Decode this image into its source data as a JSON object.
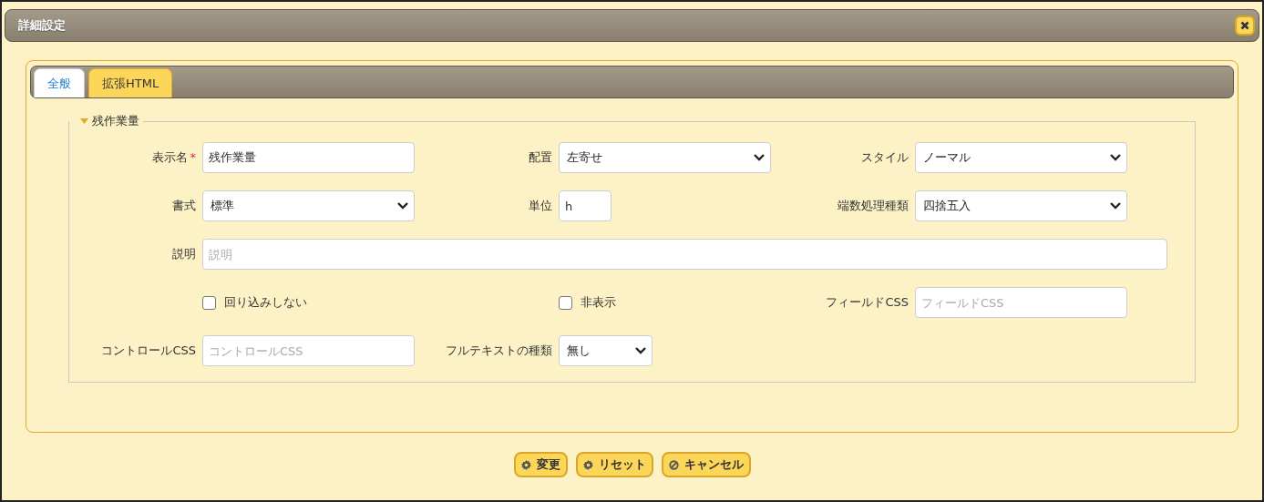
{
  "window": {
    "title": "詳細設定"
  },
  "tabs": [
    {
      "label": "全般",
      "selected": true
    },
    {
      "label": "拡張HTML",
      "selected": false
    }
  ],
  "section": {
    "title": "残作業量",
    "expanded": true
  },
  "rows": [
    [
      {
        "kind": "text",
        "label": "表示名",
        "required_mark": "*",
        "value": "残作業量"
      },
      {
        "kind": "select",
        "label": "配置",
        "value": "左寄せ"
      },
      {
        "kind": "select",
        "label": "スタイル",
        "value": "ノーマル"
      }
    ],
    [
      {
        "kind": "select",
        "label": "書式",
        "value": "標準"
      },
      {
        "kind": "text",
        "label": "単位",
        "value": "h",
        "narrow": true
      },
      {
        "kind": "select",
        "label": "端数処理種類",
        "value": "四捨五入"
      }
    ],
    [
      {
        "kind": "text",
        "label": "説明",
        "placeholder": "説明",
        "wide": true
      }
    ],
    [
      {
        "kind": "checkbox",
        "label": "回り込みしない",
        "checked": false
      },
      {
        "kind": "checkbox",
        "label": "非表示",
        "checked": false
      },
      {
        "kind": "text",
        "label": "フィールドCSS",
        "placeholder": "フィールドCSS"
      }
    ],
    [
      {
        "kind": "text",
        "label": "コントロールCSS",
        "placeholder": "コントロールCSS"
      },
      {
        "kind": "select",
        "label": "フルテキストの種類",
        "value": "無し",
        "narrow": true
      }
    ]
  ],
  "buttons": [
    {
      "kind": "apply",
      "label": "変更"
    },
    {
      "kind": "reset",
      "label": "リセット"
    },
    {
      "kind": "cancel",
      "label": "キャンセル"
    }
  ]
}
